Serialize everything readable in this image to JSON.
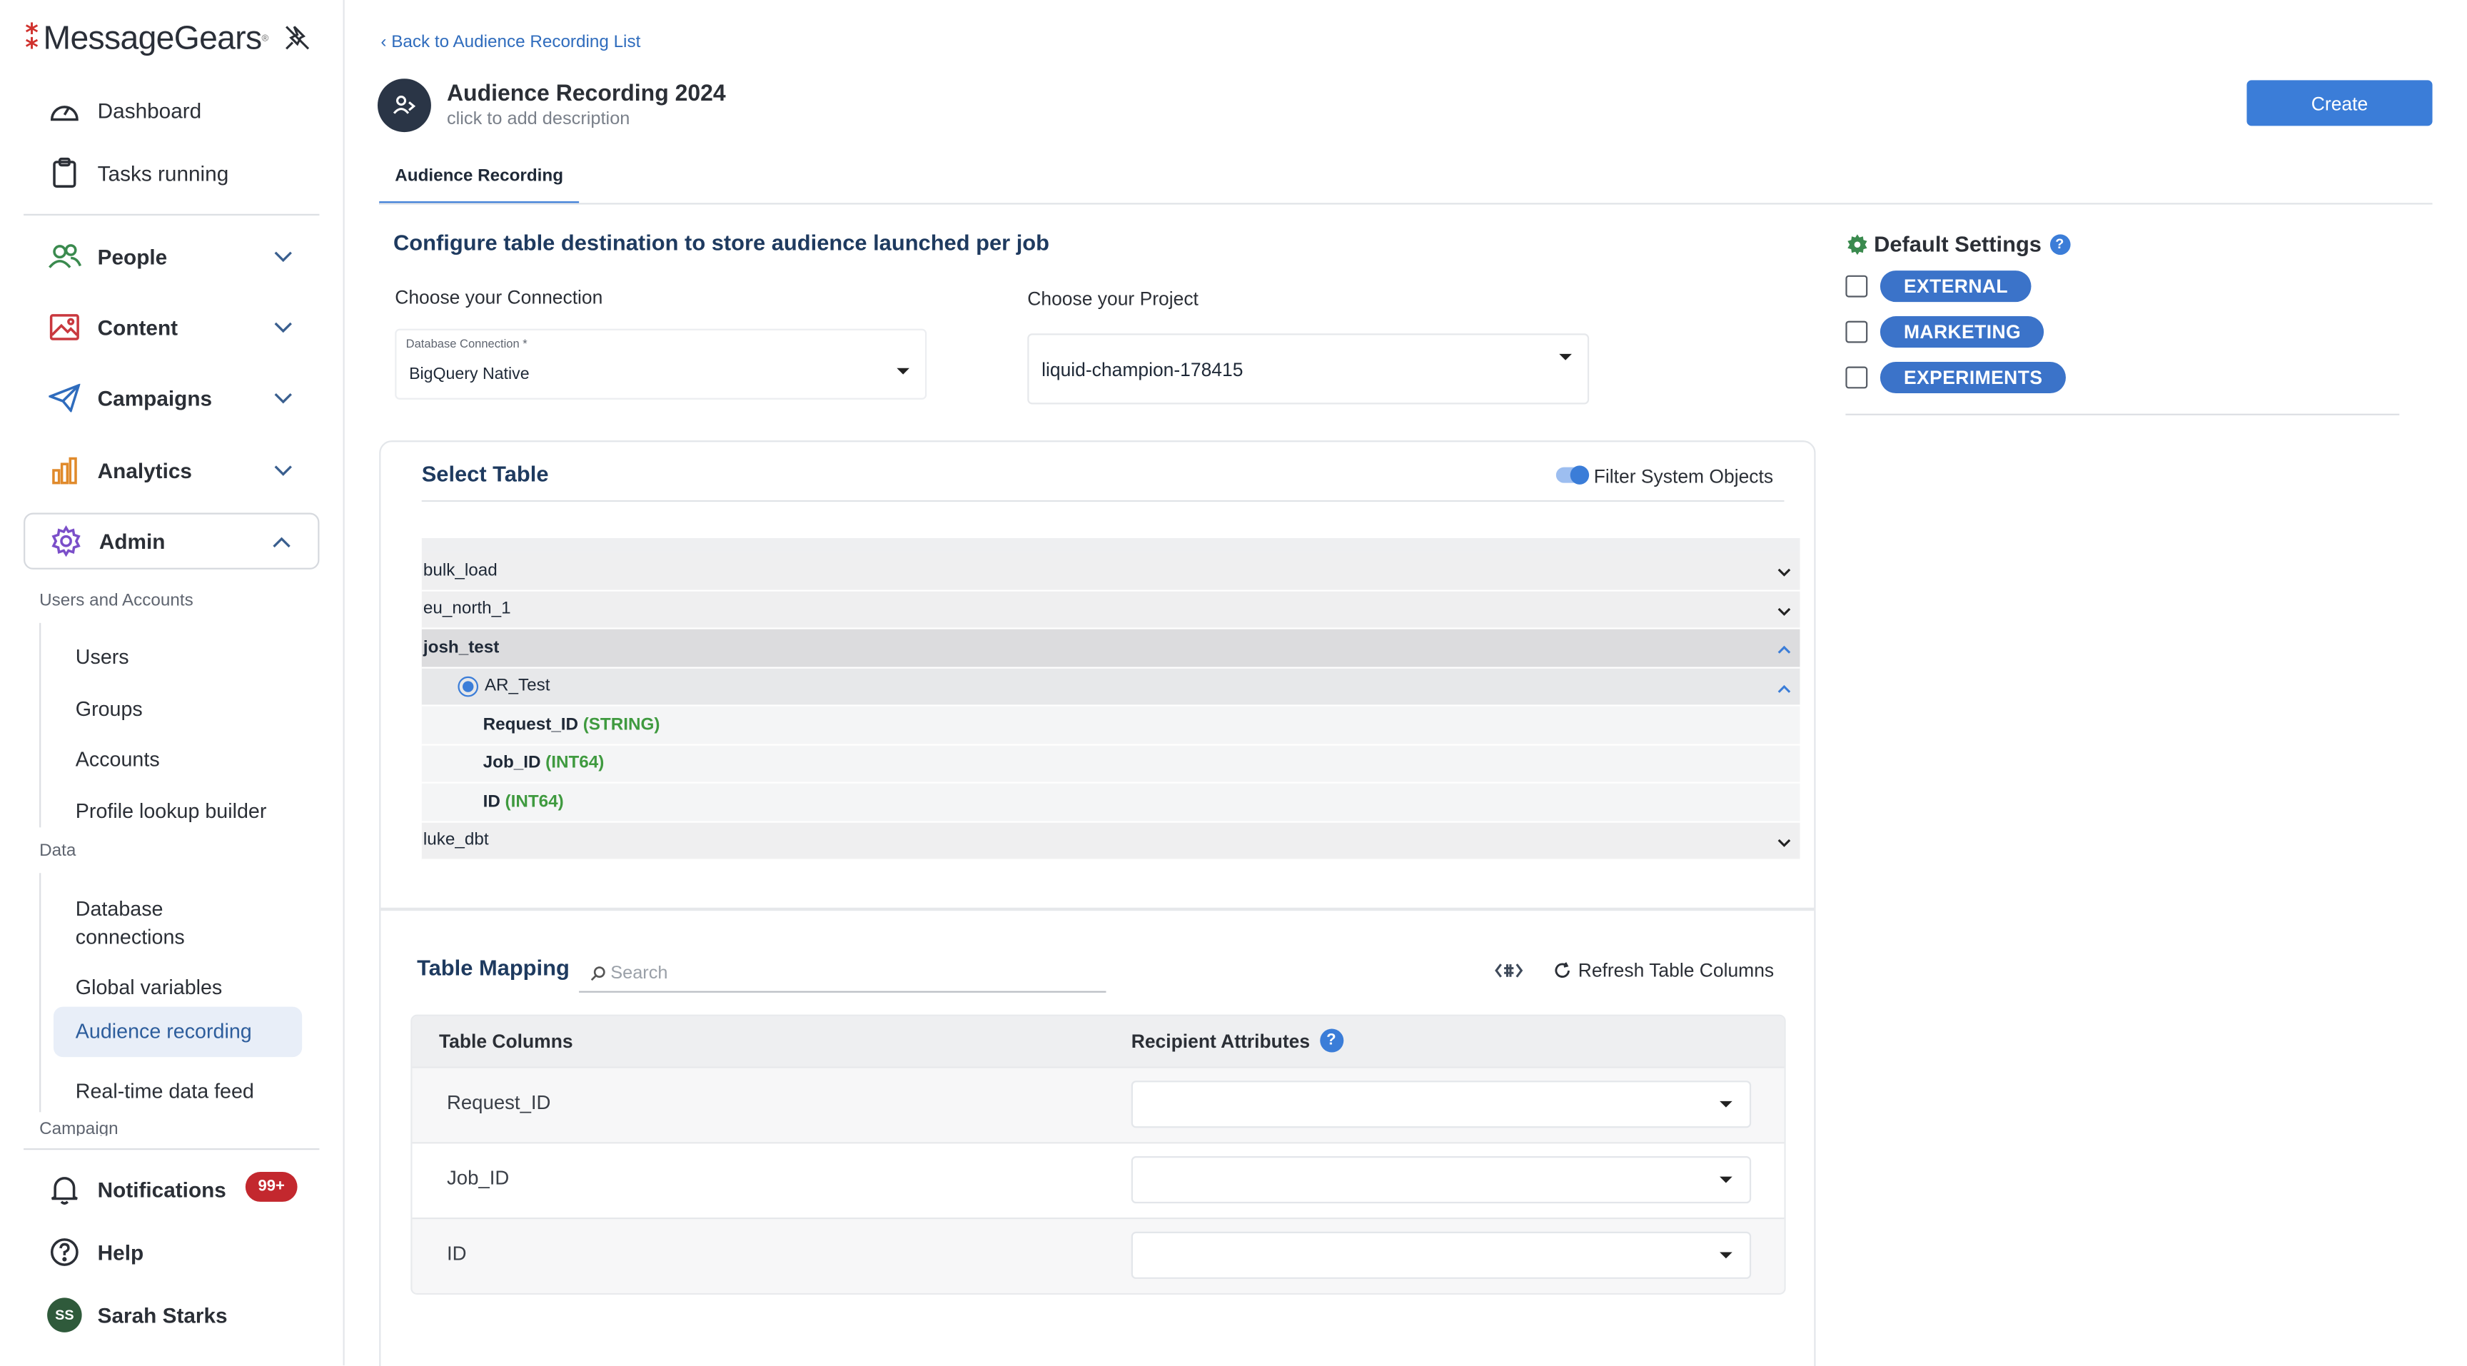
{
  "brand": {
    "name": "MessageGears",
    "tm": "®"
  },
  "sidebar": {
    "top_items": [
      {
        "label": "Dashboard"
      },
      {
        "label": "Tasks running"
      }
    ],
    "sections": [
      {
        "label": "People"
      },
      {
        "label": "Content"
      },
      {
        "label": "Campaigns"
      },
      {
        "label": "Analytics"
      },
      {
        "label": "Admin"
      }
    ],
    "group_users": "Users and Accounts",
    "users_items": [
      "Users",
      "Groups",
      "Accounts",
      "Profile lookup builder"
    ],
    "group_data": "Data",
    "data_items": [
      "Database connections",
      "Global variables",
      "Audience recording",
      "Real-time data feed"
    ],
    "group_campaign": "Campaign",
    "bottom": {
      "notifications": "Notifications",
      "notif_badge": "99+",
      "help": "Help",
      "user_name": "Sarah Starks",
      "user_initials": "SS"
    }
  },
  "header": {
    "back_link": "Back to Audience Recording List",
    "title": "Audience Recording 2024",
    "description": "click to add description",
    "create_button": "Create",
    "tab": "Audience Recording"
  },
  "config": {
    "title": "Configure table destination to store audience launched per job",
    "choose_connection": "Choose your Connection",
    "connection_field_label": "Database Connection *",
    "connection_value": "BigQuery Native",
    "choose_project": "Choose your Project",
    "project_value": "liquid-champion-178415"
  },
  "defaults": {
    "title": "Default Settings",
    "help": "?",
    "options": [
      {
        "label": "EXTERNAL",
        "checked": false
      },
      {
        "label": "MARKETING",
        "checked": false
      },
      {
        "label": "EXPERIMENTS",
        "checked": false
      }
    ]
  },
  "select_table": {
    "title": "Select Table",
    "filter_label": "Filter System Objects",
    "filter_on": true,
    "datasets": {
      "bulk_load": "bulk_load",
      "eu_north_1": "eu_north_1",
      "josh_test": "josh_test",
      "luke_dbt": "luke_dbt"
    },
    "table": "AR_Test",
    "columns": [
      {
        "name": "Request_ID",
        "type": "(STRING)"
      },
      {
        "name": "Job_ID",
        "type": "(INT64)"
      },
      {
        "name": "ID",
        "type": "(INT64)"
      }
    ]
  },
  "mapping": {
    "title": "Table Mapping",
    "search_placeholder": "Search",
    "refresh_label": "Refresh Table Columns",
    "col_header_1": "Table Columns",
    "col_header_2": "Recipient Attributes",
    "rows": [
      {
        "column": "Request_ID",
        "attribute": ""
      },
      {
        "column": "Job_ID",
        "attribute": ""
      },
      {
        "column": "ID",
        "attribute": ""
      }
    ]
  },
  "colors": {
    "accent": "#3b7dd8",
    "pill": "#3b73c9",
    "heading": "#1e3a5f",
    "type_green": "#3f9a3f",
    "badge": "#c3282e"
  }
}
